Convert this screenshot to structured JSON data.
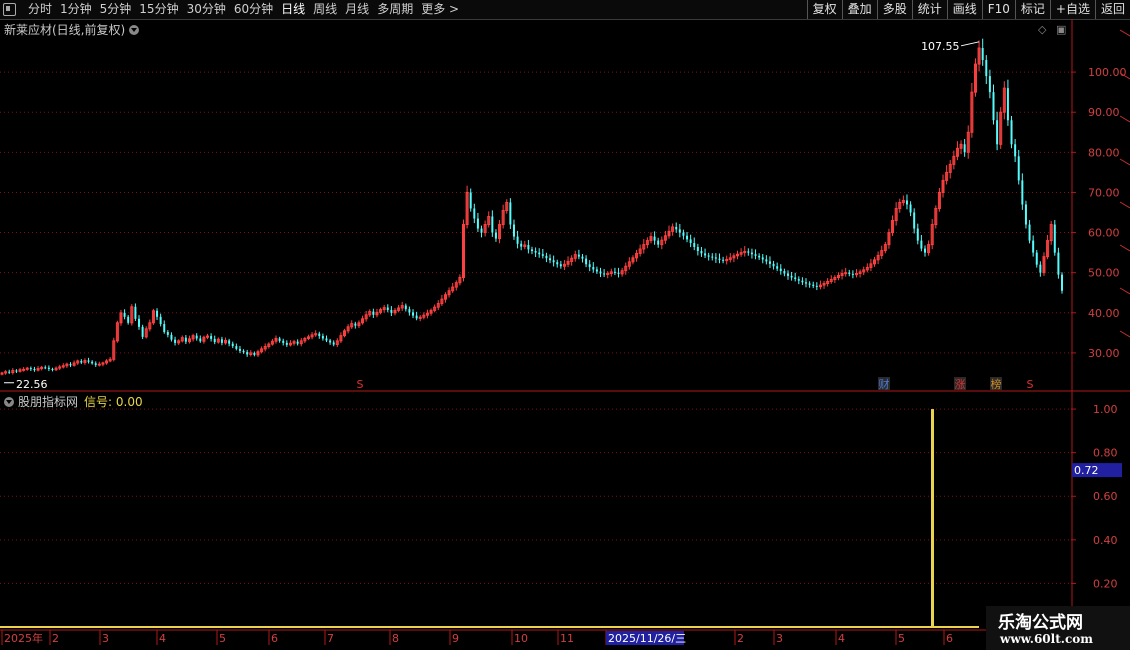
{
  "toolbar": {
    "periods": [
      "分时",
      "1分钟",
      "5分钟",
      "15分钟",
      "30分钟",
      "60分钟",
      "日线",
      "周线",
      "月线",
      "多周期",
      "更多 >"
    ],
    "active_period": "日线",
    "tools": [
      "复权",
      "叠加",
      "多股",
      "统计",
      "画线",
      "F10",
      "标记",
      "+自选",
      "返回"
    ]
  },
  "main": {
    "title": "新莱应材(日线,前复权)",
    "high_label": "107.55",
    "low_label": "22.56",
    "events": [
      "S",
      "财",
      "涨",
      "榜",
      "S"
    ],
    "colors": {
      "up": "#ff4040",
      "down": "#54fcfc",
      "grid": "#7a1414",
      "axis": "#b01818",
      "event_s": "#e03030",
      "event_cai": "#4a7ad8",
      "event_zhang": "#e03030",
      "event_bang": "#d08a20"
    }
  },
  "sub": {
    "label": "股朋指标网",
    "signal_label": "信号: 0.00",
    "current_value": "0.72",
    "signal_color": "#e8d44d"
  },
  "xaxis": {
    "labels": [
      "2025年",
      "2",
      "3",
      "4",
      "5",
      "6",
      "7",
      "8",
      "9",
      "10",
      "11",
      "2025/11/26/三",
      "2",
      "3",
      "4",
      "5",
      "6"
    ],
    "highlight": "2025/11/26/三"
  },
  "watermark": {
    "line1": "乐淘公式网",
    "line2": "www.60lt.com"
  },
  "chart_data": [
    {
      "type": "candlestick",
      "title": "新莱应材(日线,前复权)",
      "y_ticks": [
        30,
        40,
        50,
        60,
        70,
        80,
        90,
        100
      ],
      "ylim": [
        22,
        108
      ],
      "annotations": {
        "high": 107.55,
        "low": 22.56
      },
      "grid": true,
      "closes": [
        25.0,
        25.3,
        25.1,
        25.6,
        25.4,
        25.8,
        25.9,
        26.2,
        26.0,
        25.7,
        26.1,
        26.4,
        26.3,
        26.0,
        25.8,
        26.2,
        26.5,
        26.8,
        27.2,
        26.9,
        27.5,
        28.0,
        27.6,
        28.1,
        27.8,
        27.4,
        27.0,
        27.2,
        27.5,
        28.0,
        28.4,
        33.0,
        37.5,
        40.0,
        39.0,
        37.5,
        41.5,
        38.5,
        36.5,
        34.0,
        36.0,
        37.5,
        40.5,
        39.0,
        37.2,
        35.2,
        34.5,
        33.3,
        32.5,
        33.0,
        33.8,
        32.8,
        33.5,
        34.3,
        33.6,
        32.9,
        33.9,
        34.2,
        33.5,
        32.7,
        33.4,
        32.5,
        33.1,
        32.3,
        31.7,
        31.0,
        30.5,
        30.2,
        29.6,
        30.0,
        29.5,
        30.3,
        31.0,
        31.6,
        32.2,
        32.9,
        33.6,
        33.0,
        32.5,
        32.0,
        32.4,
        32.8,
        32.3,
        33.0,
        33.6,
        34.0,
        34.5,
        34.8,
        34.2,
        33.6,
        33.1,
        32.6,
        32.1,
        33.0,
        34.3,
        35.5,
        36.5,
        37.3,
        36.8,
        37.5,
        38.5,
        39.5,
        40.3,
        39.5,
        40.1,
        40.8,
        41.3,
        40.7,
        40.0,
        40.6,
        41.2,
        41.8,
        40.9,
        40.1,
        39.3,
        38.6,
        38.9,
        39.4,
        39.9,
        40.6,
        41.4,
        42.3,
        43.4,
        44.5,
        45.5,
        46.4,
        47.5,
        48.8,
        62.0,
        70.0,
        66.0,
        63.5,
        61.0,
        60.0,
        62.0,
        64.0,
        60.0,
        58.5,
        62.0,
        65.5,
        67.5,
        62.0,
        59.0,
        57.2,
        56.5,
        56.9,
        55.8,
        55.4,
        55.0,
        54.6,
        54.2,
        53.6,
        53.1,
        52.6,
        52.1,
        51.6,
        52.1,
        52.8,
        53.6,
        54.5,
        54.0,
        53.5,
        52.1,
        51.4,
        50.8,
        50.3,
        49.8,
        49.6,
        49.8,
        50.2,
        50.0,
        49.7,
        50.5,
        51.6,
        52.7,
        53.7,
        54.8,
        55.9,
        57.0,
        58.0,
        59.0,
        58.0,
        57.0,
        58.1,
        59.2,
        60.3,
        61.4,
        60.8,
        60.0,
        59.2,
        58.3,
        57.4,
        56.4,
        55.4,
        54.8,
        54.3,
        54.0,
        53.8,
        53.5,
        53.2,
        53.0,
        53.3,
        53.7,
        54.2,
        54.6,
        55.0,
        55.3,
        55.0,
        54.6,
        54.2,
        53.8,
        53.3,
        52.8,
        52.2,
        51.6,
        51.0,
        50.4,
        49.8,
        49.2,
        48.8,
        48.4,
        48.0,
        47.6,
        47.3,
        47.0,
        46.7,
        46.5,
        46.9,
        47.3,
        47.8,
        48.3,
        48.8,
        49.3,
        49.8,
        50.0,
        49.7,
        49.5,
        49.8,
        50.2,
        50.7,
        51.3,
        52.2,
        53.2,
        54.3,
        55.5,
        57.0,
        60.0,
        63.0,
        66.0,
        67.5,
        68.0,
        67.0,
        65.0,
        61.0,
        58.0,
        56.0,
        55.0,
        57.0,
        62.0,
        66.0,
        70.0,
        73.0,
        75.0,
        77.0,
        79.0,
        81.0,
        82.0,
        80.0,
        85.0,
        95.0,
        102.0,
        106.0,
        103.0,
        99.0,
        95.0,
        88.0,
        82.0,
        90.0,
        96.0,
        88.0,
        82.0,
        79.0,
        73.0,
        67.0,
        62.0,
        58.0,
        55.0,
        52.0,
        50.0,
        54.0,
        58.0,
        62.0,
        55.0,
        49.5,
        45.5
      ]
    },
    {
      "type": "bar",
      "title": "股朋指标网",
      "series": [
        {
          "name": "信号",
          "values": [
            0
          ]
        }
      ],
      "spike": {
        "value": 1.0,
        "position": "near right end"
      },
      "y_ticks": [
        0.2,
        0.4,
        0.6,
        0.8,
        1.0
      ],
      "ylim": [
        0,
        1.06
      ],
      "current_value": 0.72,
      "grid": true
    }
  ]
}
